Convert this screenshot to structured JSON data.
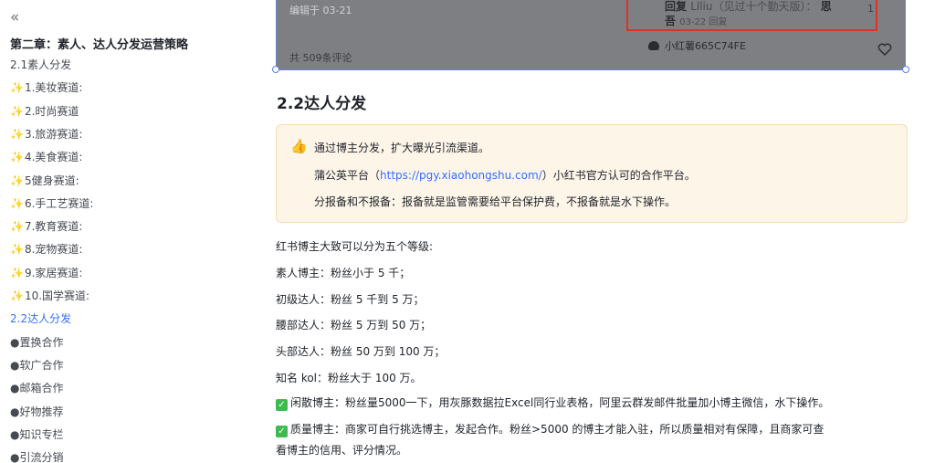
{
  "sidebar": {
    "collapse_glyph": "«",
    "chapter_title": "第二章：素人、达人分发运营策略",
    "items": [
      {
        "label": "2.1素人分发",
        "spark": false
      },
      {
        "label": "1.美妆赛道:",
        "spark": true
      },
      {
        "label": "2.时尚赛道",
        "spark": true
      },
      {
        "label": "3.旅游赛道:",
        "spark": true
      },
      {
        "label": "4.美食赛道:",
        "spark": true
      },
      {
        "label": "5健身赛道:",
        "spark": true
      },
      {
        "label": "6.手工艺赛道:",
        "spark": true
      },
      {
        "label": "7.教育赛道:",
        "spark": true
      },
      {
        "label": "8.宠物赛道:",
        "spark": true
      },
      {
        "label": "9.家居赛道:",
        "spark": true
      },
      {
        "label": "10.国学赛道:",
        "spark": true
      },
      {
        "label": "2.2达人分发",
        "spark": false,
        "active": true
      },
      {
        "label": "●置换合作",
        "spark": false
      },
      {
        "label": "●软广合作",
        "spark": false
      },
      {
        "label": "●邮箱合作",
        "spark": false
      },
      {
        "label": "●好物推荐",
        "spark": false
      },
      {
        "label": "●知识专栏",
        "spark": false
      },
      {
        "label": "●引流分销",
        "spark": false
      }
    ]
  },
  "screenshot": {
    "edited": "编辑于 03-21",
    "comments": "共 509条评论",
    "reply_prefix": "回复",
    "reply_user": "Llliu（见过十个勤天版）：",
    "reply_text": "思",
    "reply_text2": "吾",
    "reply_date": "03-22 回复",
    "reply_likes": "1",
    "user_name": "小红薯665C74FE"
  },
  "main": {
    "title": "2.2达人分发",
    "callout": {
      "icon": "👍",
      "line1": "通过博主分发，扩大曝光引流渠道。",
      "line2_prefix": "蒲公英平台（",
      "line2_link": "https://pgy.xiaohongshu.com/",
      "line2_suffix": "）小红书官方认可的合作平台。",
      "line3": "分报备和不报备：报备就是监管需要给平台保护费，不报备就是水下操作。"
    },
    "paragraphs": [
      "红书博主大致可以分为五个等级:",
      "素人博主：粉丝小于 5 千；",
      "初级达人：粉丝 5 千到 5 万；",
      "腰部达人：粉丝 5 万到 50 万；",
      "头部达人：粉丝 50 万到 100 万；",
      "知名 kol：粉丝大于 100 万。"
    ],
    "checks": [
      "闲散博主：粉丝量5000一下，用灰豚数据拉Excel同行业表格，阿里云群发邮件批量加小博主微信，水下操作。",
      "质量博主：商家可自行挑选博主，发起合作。粉丝>5000 的博主才能入驻，所以质量相对有保障，且商家可查"
    ],
    "check_continuation": "看博主的信用、评分情况。",
    "check_glyph": "✓",
    "spark_glyph": "✨"
  },
  "colors": {
    "accent": "#3370ff",
    "callout_bg": "#fef5e9",
    "check": "#3ebb4e"
  }
}
